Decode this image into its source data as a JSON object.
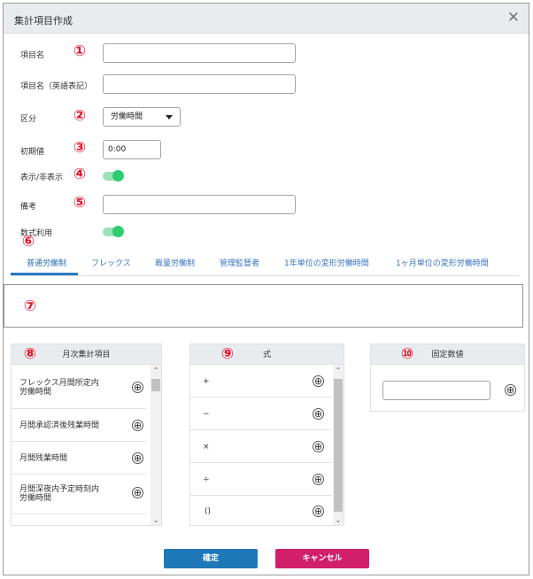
{
  "dialog": {
    "title": "集計項目作成",
    "close_glyph": "✕"
  },
  "fields": {
    "item_name": {
      "label": "項目名",
      "badge": "①",
      "value": ""
    },
    "item_name_en": {
      "label": "項目名（英語表記）",
      "value": ""
    },
    "category": {
      "label": "区分",
      "badge": "②",
      "selected": "労働時間"
    },
    "initial_value": {
      "label": "初期値",
      "badge": "③",
      "value": "0:00"
    },
    "visibility": {
      "label": "表示/非表示",
      "badge": "④",
      "on": true
    },
    "note": {
      "label": "備考",
      "badge": "⑤",
      "value": ""
    },
    "formula_use": {
      "label": "数式利用",
      "on": true
    }
  },
  "tabs": {
    "badge": "⑥",
    "items": [
      "普通労働制",
      "フレックス",
      "裁量労働制",
      "管理監督者",
      "1年単位の変形労働時間",
      "1ヶ月単位の変形労働時間"
    ],
    "active_index": 0
  },
  "formula_box": {
    "badge": "⑦"
  },
  "monthly_panel": {
    "badge": "⑧",
    "title": "月次集計項目",
    "items": [
      {
        "line1": "フレックス月間所定内",
        "line2": "労働時間"
      },
      {
        "line1": "月間承認済後残業時間",
        "line2": ""
      },
      {
        "line1": "月間残業時間",
        "line2": ""
      },
      {
        "line1": "月間深夜内予定時刻内",
        "line2": "労働時間"
      }
    ]
  },
  "operator_panel": {
    "badge": "⑨",
    "title": "式",
    "items": [
      "+",
      "−",
      "×",
      "÷",
      "()"
    ]
  },
  "fixed_panel": {
    "badge": "⑩",
    "title": "固定数値",
    "value": ""
  },
  "buttons": {
    "confirm": "確定",
    "cancel": "キャンセル"
  },
  "icons": {
    "add": "⊕",
    "scroll_up": "⌃",
    "scroll_down": "⌄"
  },
  "colors": {
    "badge": "#e8132c",
    "toggle_on": "#2ecc71",
    "tab_active": "#2a7ac0",
    "confirm": "#1e78b8",
    "cancel": "#d21f6c"
  }
}
